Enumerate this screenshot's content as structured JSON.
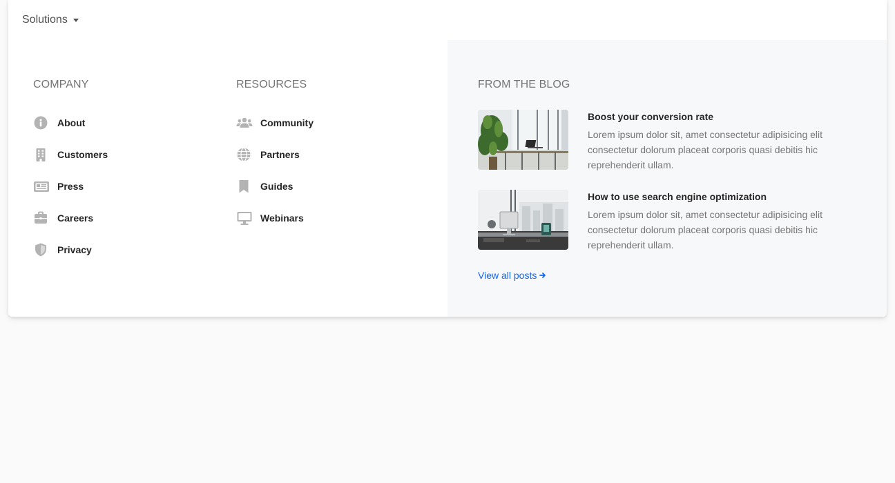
{
  "nav": {
    "toggle_label": "Solutions"
  },
  "company": {
    "heading": "COMPANY",
    "items": [
      {
        "label": "About",
        "icon": "info-circle-icon"
      },
      {
        "label": "Customers",
        "icon": "building-icon"
      },
      {
        "label": "Press",
        "icon": "newspaper-icon"
      },
      {
        "label": "Careers",
        "icon": "briefcase-icon"
      },
      {
        "label": "Privacy",
        "icon": "shield-icon"
      }
    ]
  },
  "resources": {
    "heading": "RESOURCES",
    "items": [
      {
        "label": "Community",
        "icon": "users-icon"
      },
      {
        "label": "Partners",
        "icon": "globe-icon"
      },
      {
        "label": "Guides",
        "icon": "bookmark-icon"
      },
      {
        "label": "Webinars",
        "icon": "desktop-icon"
      }
    ]
  },
  "blog": {
    "heading": "FROM THE BLOG",
    "posts": [
      {
        "title": "Boost your conversion rate",
        "text": "Lorem ipsum dolor sit, amet consectetur adipisicing elit consectetur dolorum placeat corporis quasi debitis hic reprehenderit ullam."
      },
      {
        "title": "How to use search engine optimization",
        "text": "Lorem ipsum dolor sit, amet consectetur adipisicing elit consectetur dolorum placeat corporis quasi debitis hic reprehenderit ullam."
      }
    ],
    "view_all_label": "View all posts"
  },
  "colors": {
    "link": "#1266f1",
    "icon_gray": "#b3b3b3",
    "right_pane_bg": "#f7f8fa",
    "page_bg": "#fafafa"
  }
}
